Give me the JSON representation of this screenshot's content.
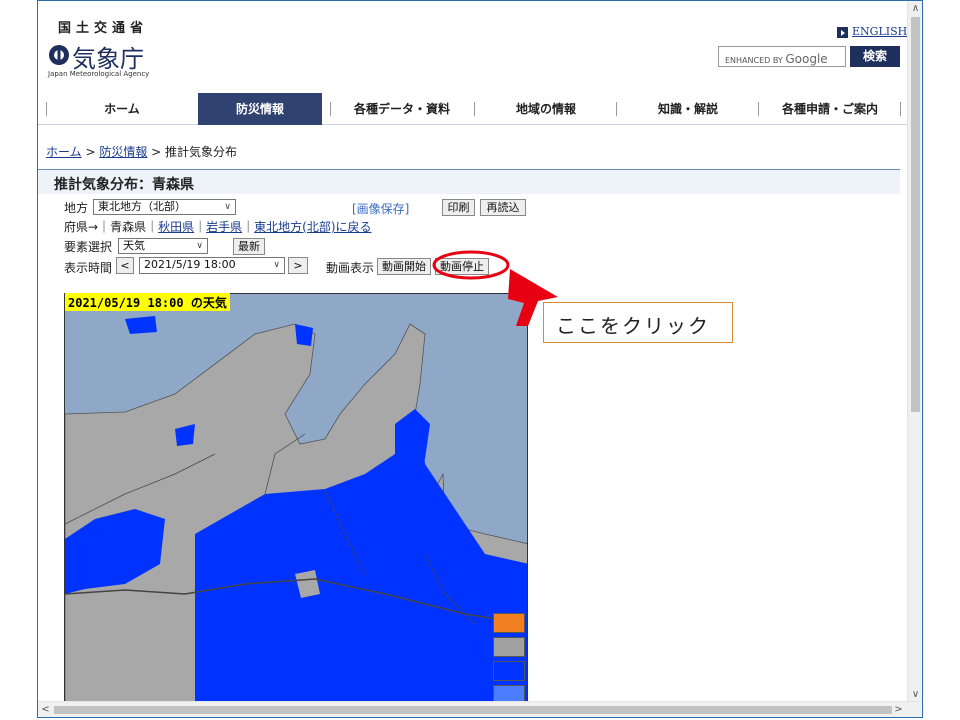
{
  "header": {
    "ministry": "国土交通省",
    "agency": "気象庁",
    "agency_en": "Japan Meteorological Agency",
    "english_link": "ENGLISH",
    "search_placeholder_prefix": "ENHANCED BY ",
    "search_placeholder_brand": "Google",
    "search_button": "検索"
  },
  "nav": {
    "items": [
      {
        "label": "ホーム",
        "active": false
      },
      {
        "label": "防災情報",
        "active": true
      },
      {
        "label": "各種データ・資料",
        "active": false
      },
      {
        "label": "地域の情報",
        "active": false
      },
      {
        "label": "知識・解説",
        "active": false
      },
      {
        "label": "各種申請・ご案内",
        "active": false
      }
    ]
  },
  "breadcrumb": {
    "home": "ホーム",
    "sep": " > ",
    "disaster": "防災情報",
    "current": "推計気象分布"
  },
  "page_title": "推計気象分布：青森県",
  "controls": {
    "region_label": "地方",
    "region_value": "東北地方（北部）",
    "save_image": "[画像保存]",
    "print_button": "印刷",
    "reload_button": "再読込",
    "pref_prefix": "府県→｜",
    "pref_current": "青森県",
    "pref_sep": "｜",
    "pref_akita": "秋田県",
    "pref_iwate": "岩手県",
    "pref_back": "東北地方(北部)に戻る",
    "element_label": "要素選択",
    "element_value": "天気",
    "latest_button": "最新",
    "time_label": "表示時間",
    "prev_button": "<",
    "time_value": "2021/5/19 18:00",
    "next_button": ">",
    "animation_label": "動画表示",
    "animation_start": "動画開始",
    "animation_stop": "動画停止"
  },
  "map": {
    "caption": "2021/05/19 18:00 の天気",
    "colors": {
      "sea": "#8fa8c8",
      "land": "#a8a8a8",
      "rain": "#0033ff",
      "border": "#333333"
    },
    "legend": [
      {
        "name": "sunny-icon",
        "bg": "#f08020"
      },
      {
        "name": "cloudy-icon",
        "bg": "#a0a0a0"
      },
      {
        "name": "rain-icon",
        "bg": "#0033ff"
      },
      {
        "name": "snow-icon",
        "bg": "#4d7dff"
      }
    ]
  },
  "annotation": {
    "callout_text": "ここをクリック",
    "highlight_color": "#e60012"
  }
}
